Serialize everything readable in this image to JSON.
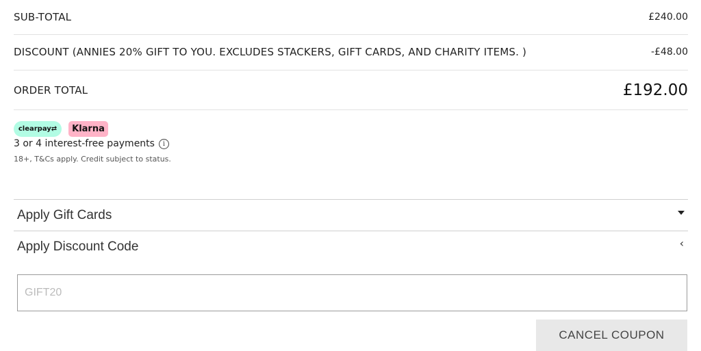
{
  "summary": {
    "subtotal_label": "SUB-TOTAL",
    "subtotal_value": "£240.00",
    "discount_label": "DISCOUNT (ANNIES 20% GIFT TO YOU. EXCLUDES STACKERS, GIFT CARDS, AND CHARITY ITEMS. )",
    "discount_value": "-£48.00",
    "total_label": "ORDER TOTAL",
    "total_value": "£192.00"
  },
  "payments": {
    "clearpay_label": "clearpay⇄",
    "klarna_label": "Klarna",
    "installments_text": "3 or 4 interest-free payments",
    "info_icon": "i",
    "terms_text": "18+, T&Cs apply. Credit subject to status."
  },
  "accordions": {
    "gift_cards_label": "Apply Gift Cards",
    "discount_code_label": "Apply Discount Code",
    "chevron": "‹"
  },
  "coupon": {
    "placeholder": "GIFT20",
    "cancel_label": "CANCEL COUPON"
  },
  "colors": {
    "clearpay": "#b2fce4",
    "klarna": "#ffb3c7",
    "button_bg": "#e8e8e8"
  }
}
